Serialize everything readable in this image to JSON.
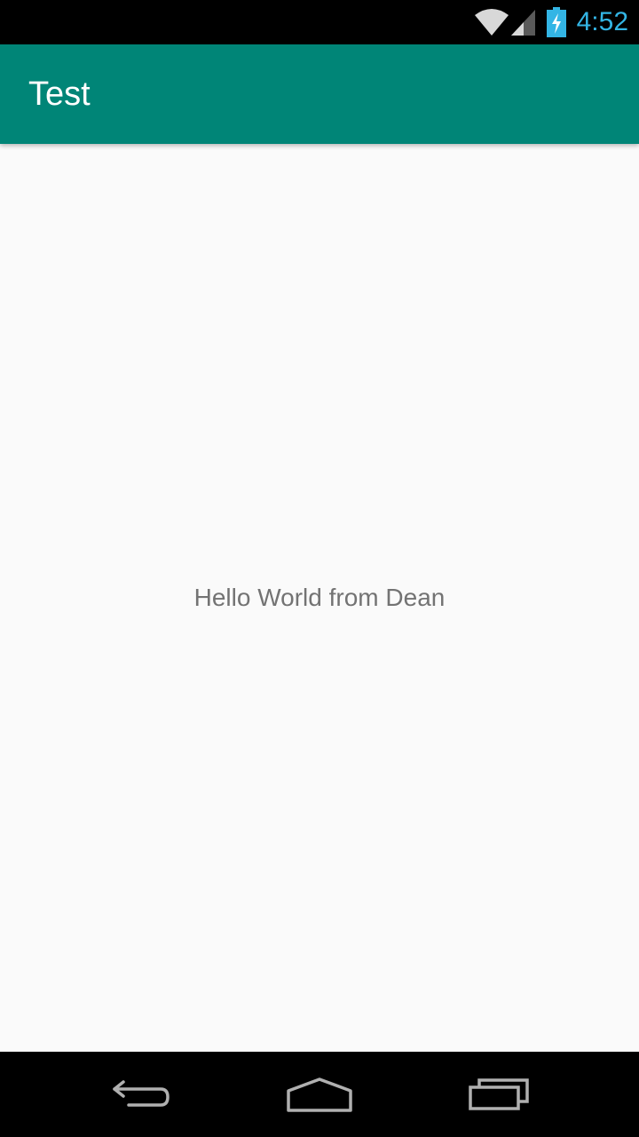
{
  "status_bar": {
    "time": "4:52",
    "icons": [
      "wifi-icon",
      "signal-icon",
      "battery-charging-icon"
    ],
    "clock_color": "#33b5e5"
  },
  "app_bar": {
    "title": "Test",
    "background_color": "#008577"
  },
  "main": {
    "message": "Hello World from Dean"
  },
  "nav_bar": {
    "icons": [
      "back-icon",
      "home-icon",
      "recents-icon"
    ]
  }
}
